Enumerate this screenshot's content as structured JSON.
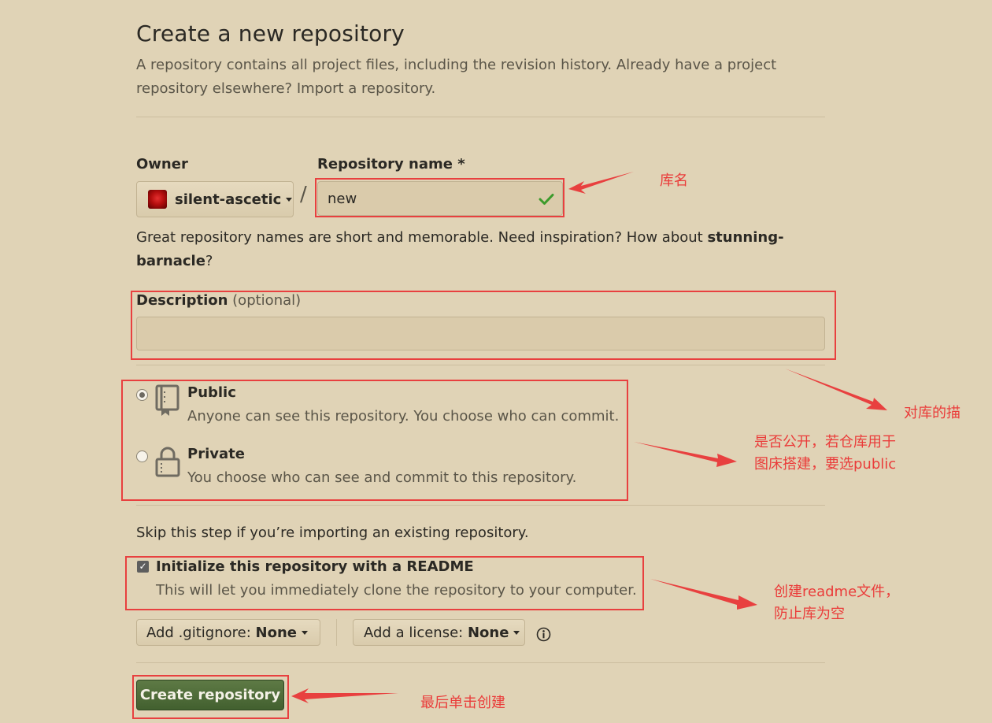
{
  "header": {
    "title": "Create a new repository",
    "subtitle": "A repository contains all project files, including the revision history. Already have a project repository elsewhere? Import a repository."
  },
  "owner": {
    "label": "Owner",
    "value": "silent-ascetic"
  },
  "slash": "/",
  "repo_name": {
    "label": "Repository name *",
    "value": "new"
  },
  "name_hint": {
    "text": "Great repository names are short and memorable. Need inspiration? How about ",
    "suggestion": "stunning-barnacle",
    "suffix": "?"
  },
  "description": {
    "label": "Description",
    "optional": "(optional)",
    "value": ""
  },
  "visibility": {
    "selected": "Public",
    "public": {
      "title": "Public",
      "desc": "Anyone can see this repository. You choose who can commit."
    },
    "private": {
      "title": "Private",
      "desc": "You choose who can see and commit to this repository."
    }
  },
  "skip_text": "Skip this step if you’re importing an existing repository.",
  "readme": {
    "checked": true,
    "title": "Initialize this repository with a README",
    "desc": "This will let you immediately clone the repository to your computer."
  },
  "gitignore": {
    "prefix": "Add .gitignore:",
    "value": "None"
  },
  "license": {
    "prefix": "Add a license:",
    "value": "None"
  },
  "info_icon": "info-icon",
  "submit": {
    "label": "Create repository"
  },
  "annotations": {
    "repo_name": "库名",
    "description": "对库的描",
    "visibility_line1": "是否公开，若仓库用于",
    "visibility_line2": "图床搭建，要选public",
    "readme_line1": "创建readme文件，",
    "readme_line2": "防止库为空",
    "submit": "最后单击创建"
  },
  "colors": {
    "background": "#e0d3b6",
    "annotation": "#ea3c3a",
    "primary_button": "#4f6b39"
  }
}
